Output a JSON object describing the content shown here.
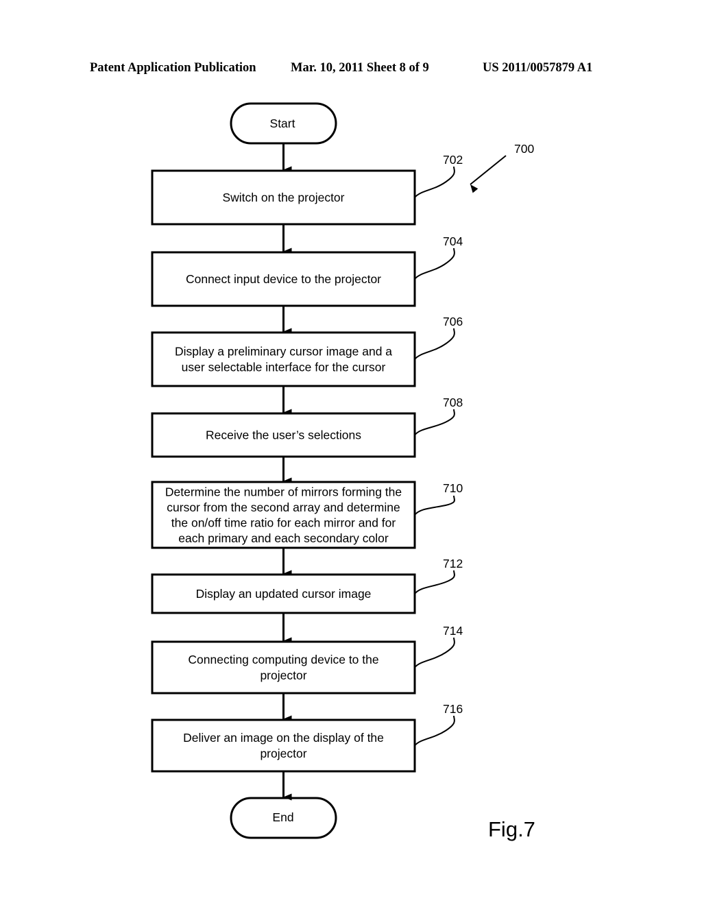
{
  "header": {
    "publication": "Patent Application Publication",
    "date_sheet": "Mar. 10, 2011  Sheet 8 of 9",
    "number": "US 2011/0057879 A1"
  },
  "diagram": {
    "figure_ref": "700",
    "figure_label": "Fig.7",
    "start": "Start",
    "end": "End",
    "steps": [
      {
        "ref": "702",
        "lines": [
          "Switch on the projector"
        ]
      },
      {
        "ref": "704",
        "lines": [
          "Connect input device to the projector"
        ]
      },
      {
        "ref": "706",
        "lines": [
          "Display a preliminary cursor image and a",
          "user selectable interface for the cursor"
        ]
      },
      {
        "ref": "708",
        "lines": [
          "Receive the user’s selections"
        ]
      },
      {
        "ref": "710",
        "lines": [
          "Determine the number of mirrors forming the",
          "cursor from the second array and determine",
          "the on/off time ratio for each mirror and for",
          "each primary and each secondary color"
        ]
      },
      {
        "ref": "712",
        "lines": [
          "Display an updated cursor image"
        ]
      },
      {
        "ref": "714",
        "lines": [
          "Connecting computing device to the",
          "projector"
        ]
      },
      {
        "ref": "716",
        "lines": [
          "Deliver an image on the display of the",
          "projector"
        ]
      }
    ]
  }
}
